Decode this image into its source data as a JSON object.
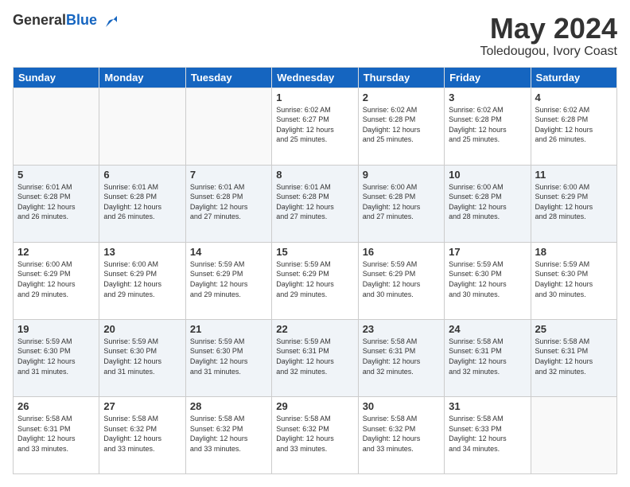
{
  "logo": {
    "general": "General",
    "blue": "Blue"
  },
  "header": {
    "month": "May 2024",
    "location": "Toledougou, Ivory Coast"
  },
  "weekdays": [
    "Sunday",
    "Monday",
    "Tuesday",
    "Wednesday",
    "Thursday",
    "Friday",
    "Saturday"
  ],
  "weeks": [
    [
      {
        "day": "",
        "info": ""
      },
      {
        "day": "",
        "info": ""
      },
      {
        "day": "",
        "info": ""
      },
      {
        "day": "1",
        "info": "Sunrise: 6:02 AM\nSunset: 6:27 PM\nDaylight: 12 hours\nand 25 minutes."
      },
      {
        "day": "2",
        "info": "Sunrise: 6:02 AM\nSunset: 6:28 PM\nDaylight: 12 hours\nand 25 minutes."
      },
      {
        "day": "3",
        "info": "Sunrise: 6:02 AM\nSunset: 6:28 PM\nDaylight: 12 hours\nand 25 minutes."
      },
      {
        "day": "4",
        "info": "Sunrise: 6:02 AM\nSunset: 6:28 PM\nDaylight: 12 hours\nand 26 minutes."
      }
    ],
    [
      {
        "day": "5",
        "info": "Sunrise: 6:01 AM\nSunset: 6:28 PM\nDaylight: 12 hours\nand 26 minutes."
      },
      {
        "day": "6",
        "info": "Sunrise: 6:01 AM\nSunset: 6:28 PM\nDaylight: 12 hours\nand 26 minutes."
      },
      {
        "day": "7",
        "info": "Sunrise: 6:01 AM\nSunset: 6:28 PM\nDaylight: 12 hours\nand 27 minutes."
      },
      {
        "day": "8",
        "info": "Sunrise: 6:01 AM\nSunset: 6:28 PM\nDaylight: 12 hours\nand 27 minutes."
      },
      {
        "day": "9",
        "info": "Sunrise: 6:00 AM\nSunset: 6:28 PM\nDaylight: 12 hours\nand 27 minutes."
      },
      {
        "day": "10",
        "info": "Sunrise: 6:00 AM\nSunset: 6:28 PM\nDaylight: 12 hours\nand 28 minutes."
      },
      {
        "day": "11",
        "info": "Sunrise: 6:00 AM\nSunset: 6:29 PM\nDaylight: 12 hours\nand 28 minutes."
      }
    ],
    [
      {
        "day": "12",
        "info": "Sunrise: 6:00 AM\nSunset: 6:29 PM\nDaylight: 12 hours\nand 29 minutes."
      },
      {
        "day": "13",
        "info": "Sunrise: 6:00 AM\nSunset: 6:29 PM\nDaylight: 12 hours\nand 29 minutes."
      },
      {
        "day": "14",
        "info": "Sunrise: 5:59 AM\nSunset: 6:29 PM\nDaylight: 12 hours\nand 29 minutes."
      },
      {
        "day": "15",
        "info": "Sunrise: 5:59 AM\nSunset: 6:29 PM\nDaylight: 12 hours\nand 29 minutes."
      },
      {
        "day": "16",
        "info": "Sunrise: 5:59 AM\nSunset: 6:29 PM\nDaylight: 12 hours\nand 30 minutes."
      },
      {
        "day": "17",
        "info": "Sunrise: 5:59 AM\nSunset: 6:30 PM\nDaylight: 12 hours\nand 30 minutes."
      },
      {
        "day": "18",
        "info": "Sunrise: 5:59 AM\nSunset: 6:30 PM\nDaylight: 12 hours\nand 30 minutes."
      }
    ],
    [
      {
        "day": "19",
        "info": "Sunrise: 5:59 AM\nSunset: 6:30 PM\nDaylight: 12 hours\nand 31 minutes."
      },
      {
        "day": "20",
        "info": "Sunrise: 5:59 AM\nSunset: 6:30 PM\nDaylight: 12 hours\nand 31 minutes."
      },
      {
        "day": "21",
        "info": "Sunrise: 5:59 AM\nSunset: 6:30 PM\nDaylight: 12 hours\nand 31 minutes."
      },
      {
        "day": "22",
        "info": "Sunrise: 5:59 AM\nSunset: 6:31 PM\nDaylight: 12 hours\nand 32 minutes."
      },
      {
        "day": "23",
        "info": "Sunrise: 5:58 AM\nSunset: 6:31 PM\nDaylight: 12 hours\nand 32 minutes."
      },
      {
        "day": "24",
        "info": "Sunrise: 5:58 AM\nSunset: 6:31 PM\nDaylight: 12 hours\nand 32 minutes."
      },
      {
        "day": "25",
        "info": "Sunrise: 5:58 AM\nSunset: 6:31 PM\nDaylight: 12 hours\nand 32 minutes."
      }
    ],
    [
      {
        "day": "26",
        "info": "Sunrise: 5:58 AM\nSunset: 6:31 PM\nDaylight: 12 hours\nand 33 minutes."
      },
      {
        "day": "27",
        "info": "Sunrise: 5:58 AM\nSunset: 6:32 PM\nDaylight: 12 hours\nand 33 minutes."
      },
      {
        "day": "28",
        "info": "Sunrise: 5:58 AM\nSunset: 6:32 PM\nDaylight: 12 hours\nand 33 minutes."
      },
      {
        "day": "29",
        "info": "Sunrise: 5:58 AM\nSunset: 6:32 PM\nDaylight: 12 hours\nand 33 minutes."
      },
      {
        "day": "30",
        "info": "Sunrise: 5:58 AM\nSunset: 6:32 PM\nDaylight: 12 hours\nand 33 minutes."
      },
      {
        "day": "31",
        "info": "Sunrise: 5:58 AM\nSunset: 6:33 PM\nDaylight: 12 hours\nand 34 minutes."
      },
      {
        "day": "",
        "info": ""
      }
    ]
  ]
}
